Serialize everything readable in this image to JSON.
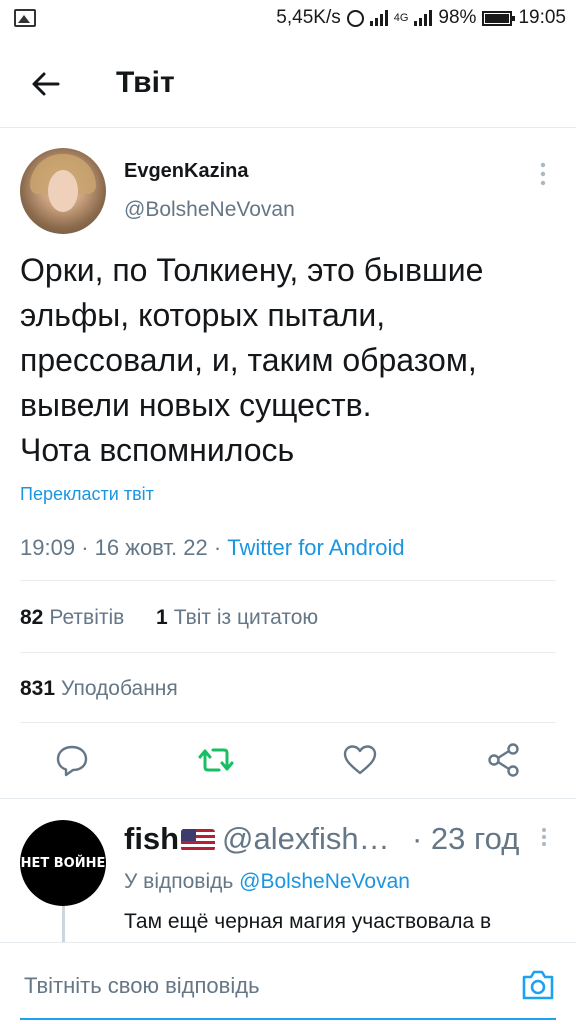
{
  "status_bar": {
    "speed": "5,45K/s",
    "network": "4G",
    "battery": "98%",
    "time": "19:05"
  },
  "header": {
    "title": "Твіт"
  },
  "tweet": {
    "display_name": "EvgenKazina",
    "handle": "@BolsheNeVovan",
    "text": "Орки, по Толкиену, это бывшие\nэльфы, которых пытали,\nпрессовали, и, таким образом,\nвывели новых существ.\nЧота вспомнилось",
    "translate": "Перекласти твіт",
    "time": "19:09",
    "date": "16 жовт. 22",
    "source": "Twitter for Android",
    "retweets_count": "82",
    "retweets_label": "Ретвітів",
    "quotes_count": "1",
    "quotes_label": "Твіт із цитатою",
    "likes_count": "831",
    "likes_label": "Уподобання"
  },
  "actions": {
    "reply_icon": "reply-icon",
    "retweet_icon": "retweet-icon",
    "like_icon": "heart-icon",
    "share_icon": "share-icon",
    "retweet_color": "#17bf63"
  },
  "reply": {
    "avatar_text": "НЕТ ВОЙНЕ",
    "display_name": "fish",
    "handle": "@alexfish…",
    "time": "· 23 год",
    "reply_to_label": "У відповідь",
    "reply_to_handle": "@BolsheNeVovan",
    "text": "Там ещё черная магия участвовала в"
  },
  "compose": {
    "placeholder": "Твітніть свою відповідь"
  },
  "colors": {
    "accent": "#1da1f2",
    "link": "#1b95e0",
    "secondary_text": "#657786"
  }
}
